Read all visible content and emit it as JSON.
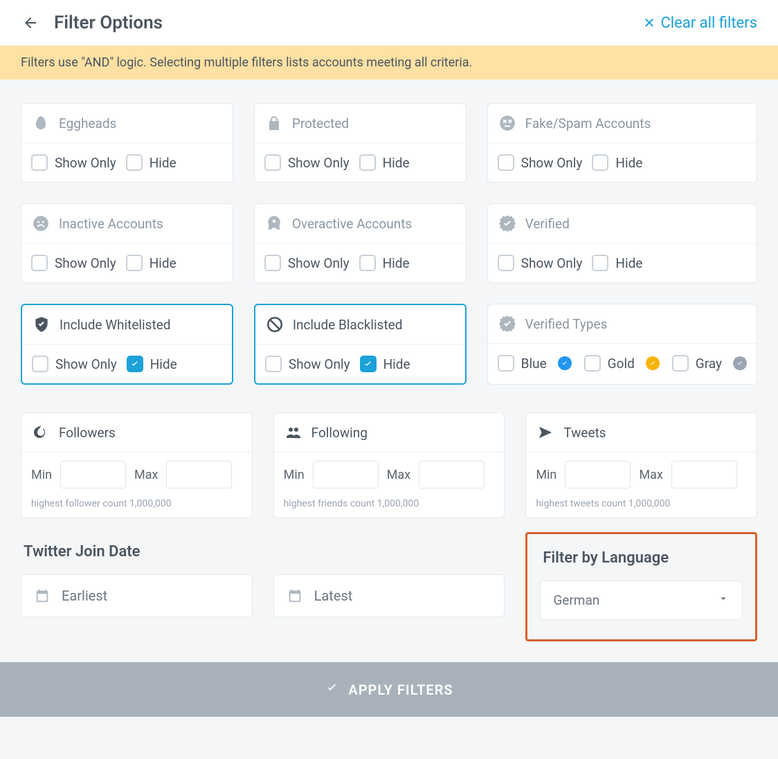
{
  "header": {
    "title": "Filter Options",
    "clear": "Clear all filters"
  },
  "info": "Filters use \"AND\" logic. Selecting multiple filters lists accounts meeting all criteria.",
  "labels": {
    "show_only": "Show Only",
    "hide": "Hide",
    "min": "Min",
    "max": "Max"
  },
  "cards": {
    "eggheads": "Eggheads",
    "protected": "Protected",
    "fakespam": "Fake/Spam Accounts",
    "inactive": "Inactive Accounts",
    "overactive": "Overactive Accounts",
    "verified": "Verified",
    "whitelisted": "Include Whitelisted",
    "blacklisted": "Include Blacklisted",
    "verified_types": "Verified Types",
    "vt_blue": "Blue",
    "vt_gold": "Gold",
    "vt_gray": "Gray",
    "followers": "Followers",
    "following": "Following",
    "tweets": "Tweets"
  },
  "hints": {
    "followers": "highest follower count 1,000,000",
    "following": "highest friends count 1,000,000",
    "tweets": "highest tweets count 1,000,000"
  },
  "join": {
    "title": "Twitter Join Date",
    "earliest": "Earliest",
    "latest": "Latest"
  },
  "lang": {
    "title": "Filter by Language",
    "selected": "German"
  },
  "apply": "APPLY FILTERS"
}
